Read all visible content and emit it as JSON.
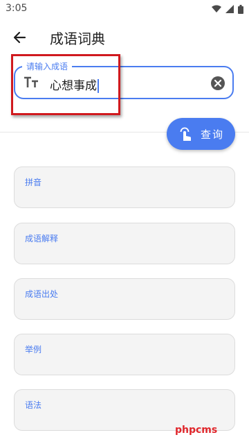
{
  "status_bar": {
    "time": "3:05",
    "icons": [
      "wifi-icon",
      "signal-icon",
      "battery-icon"
    ]
  },
  "app_bar": {
    "title": "成语词典",
    "back_icon": "arrow-back-icon"
  },
  "search": {
    "label": "请输入成语",
    "value": "心想事成",
    "leading_icon": "text-fields-icon",
    "trailing_icon": "clear-icon"
  },
  "query_button": {
    "label": "查询",
    "icon": "touch-icon"
  },
  "result_fields": [
    {
      "label": "拼音"
    },
    {
      "label": "成语解释"
    },
    {
      "label": "成语出处"
    },
    {
      "label": "举例"
    },
    {
      "label": "语法"
    }
  ],
  "watermark": "phpcms",
  "colors": {
    "accent": "#4a7cf0",
    "annotation": "#d0191e",
    "card_bg": "#f4f4f4",
    "watermark": "#e0262b"
  }
}
